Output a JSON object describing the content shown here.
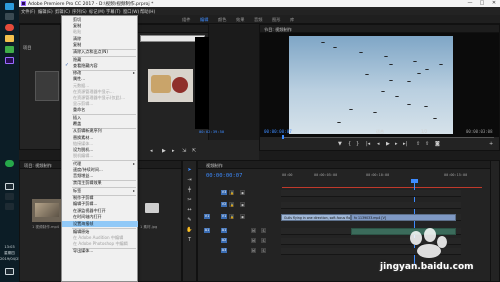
{
  "window": {
    "title": "Adobe Premiere Pro CC 2017 - D:\\视频\\视频制作.prproj *",
    "buttons": [
      "—",
      "□",
      "✕"
    ]
  },
  "menubar": [
    "文件(F)",
    "编辑(E)",
    "剪辑(C)",
    "序列(S)",
    "标记(M)",
    "字幕(T)",
    "窗口(W)",
    "帮助(H)"
  ],
  "workspaces": [
    "组件",
    "编辑",
    "颜色",
    "效果",
    "音频",
    "图形",
    "库"
  ],
  "context_menu": {
    "items": [
      {
        "label": "剪切",
        "enabled": true
      },
      {
        "label": "复制",
        "enabled": true
      },
      {
        "label": "粘贴",
        "enabled": false
      },
      {
        "label": "清除",
        "enabled": true
      },
      {
        "label": "复制",
        "enabled": true
      },
      {
        "label": "清除入点和出点(N)",
        "enabled": true
      },
      {
        "label": "隐藏",
        "enabled": true
      },
      {
        "label": "查看隐藏内容",
        "enabled": true,
        "checked": true
      },
      {
        "label": "修改",
        "enabled": true,
        "submenu": true
      },
      {
        "label": "属性...",
        "enabled": true
      },
      {
        "label": "元数据...",
        "enabled": false
      },
      {
        "label": "在资源管理器中显示...",
        "enabled": false
      },
      {
        "label": "在资源管理器中显示(仅此)...",
        "enabled": false
      },
      {
        "label": "显示剪辑...",
        "enabled": false
      },
      {
        "label": "重命名",
        "enabled": true
      },
      {
        "label": "插入",
        "enabled": true
      },
      {
        "label": "覆盖",
        "enabled": true
      },
      {
        "label": "从剪辑新建序列",
        "enabled": true
      },
      {
        "label": "替换素材...",
        "enabled": true
      },
      {
        "label": "链接媒体...",
        "enabled": false
      },
      {
        "label": "设为脱机...",
        "enabled": true
      },
      {
        "label": "脱机编辑...",
        "enabled": false
      },
      {
        "label": "代理",
        "enabled": true,
        "submenu": true
      },
      {
        "label": "速度/持续时间...",
        "enabled": true
      },
      {
        "label": "音频增益...",
        "enabled": true
      },
      {
        "label": "禁用主剪辑效果",
        "enabled": true
      },
      {
        "label": "标签",
        "enabled": true,
        "submenu": true
      },
      {
        "label": "制作子剪辑",
        "enabled": true
      },
      {
        "label": "编辑子剪辑...",
        "enabled": true
      },
      {
        "label": "在源监视器中打开",
        "enabled": true
      },
      {
        "label": "在时间轴内打开",
        "enabled": true
      },
      {
        "label": "设置海报帧",
        "enabled": true,
        "highlight": true
      },
      {
        "label": "编辑原始",
        "enabled": true
      },
      {
        "label": "在 Adobe Audition 中编辑",
        "enabled": false
      },
      {
        "label": "在 Adobe Photoshop 中编辑",
        "enabled": false
      },
      {
        "label": "导出媒体...",
        "enabled": true
      }
    ]
  },
  "project_panel": {
    "tab": "项目: 视频制作",
    "thumbnail_label": "3 项",
    "media_label": "1 视频制作.mp4",
    "media_label2": "1 素材.jpg"
  },
  "source_monitor": {
    "timecode": "00:02:39:50"
  },
  "program_monitor": {
    "tab": "节目: 视频制作",
    "timecode_left": "00:00:00:07",
    "fit": "适合",
    "timecode_right": "00:00:03:08",
    "scale": "1/2"
  },
  "timeline": {
    "tab": "视频制作",
    "timecode": "00:00:00:07",
    "ruler": [
      "00:00",
      "00:00:05:00",
      "00:00:10:00",
      "00:00:15:00"
    ],
    "tracks": [
      "V3",
      "V2",
      "V1",
      "A1",
      "A2",
      "A3"
    ],
    "source_patch": [
      "V1",
      "A1"
    ],
    "clip_v1": "Gulls flying in one direction, soft-focus flock 1139033.mp4",
    "clip_v1_b": "fx 1139033.mp4 [V]"
  },
  "taskbar": {
    "time": "13:03",
    "weekday": "星期四",
    "date": "2019/04/25"
  },
  "watermark": "jingyan.baidu.com",
  "colors": {
    "accent": "#3d8bff",
    "highlight": "#91c9f7",
    "playhead": "#3d8bff",
    "clip_video": "#9fb6d6",
    "clip_audio": "#3b6b5b"
  }
}
